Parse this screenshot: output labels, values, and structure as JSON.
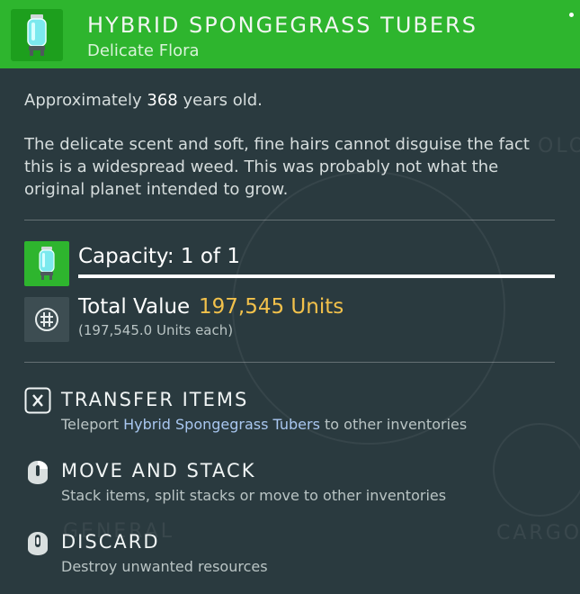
{
  "header": {
    "title": "HYBRID SPONGEGRASS TUBERS",
    "subtitle": "Delicate Flora",
    "icon": "tuber-canister-icon",
    "color": "#2eb52e"
  },
  "age": {
    "prefix": "Approximately",
    "years": "368",
    "suffix": "years old."
  },
  "description": "The delicate scent and soft, fine hairs cannot disguise the fact this is a widespread weed. This was probably not what the original planet intended to grow.",
  "capacity": {
    "label": "Capacity: 1 of 1",
    "fill_fraction": 1.0,
    "icon": "tuber-canister-icon"
  },
  "value": {
    "label": "Total Value",
    "amount": "197,545 Units",
    "each": "(197,545.0 Units each)",
    "icon": "units-currency-icon",
    "amount_color": "#f2c14b"
  },
  "actions": [
    {
      "key_icon": "x-key-icon",
      "label": "TRANSFER ITEMS",
      "desc_prefix": "Teleport",
      "desc_highlight": "Hybrid Spongegrass Tubers",
      "desc_suffix": "to other inventories"
    },
    {
      "key_icon": "mouse-right-icon",
      "label": "MOVE AND STACK",
      "desc": "Stack items, split stacks or move to other inventories"
    },
    {
      "key_icon": "mouse-middle-icon",
      "label": "DISCARD",
      "desc": "Destroy unwanted resources"
    }
  ]
}
